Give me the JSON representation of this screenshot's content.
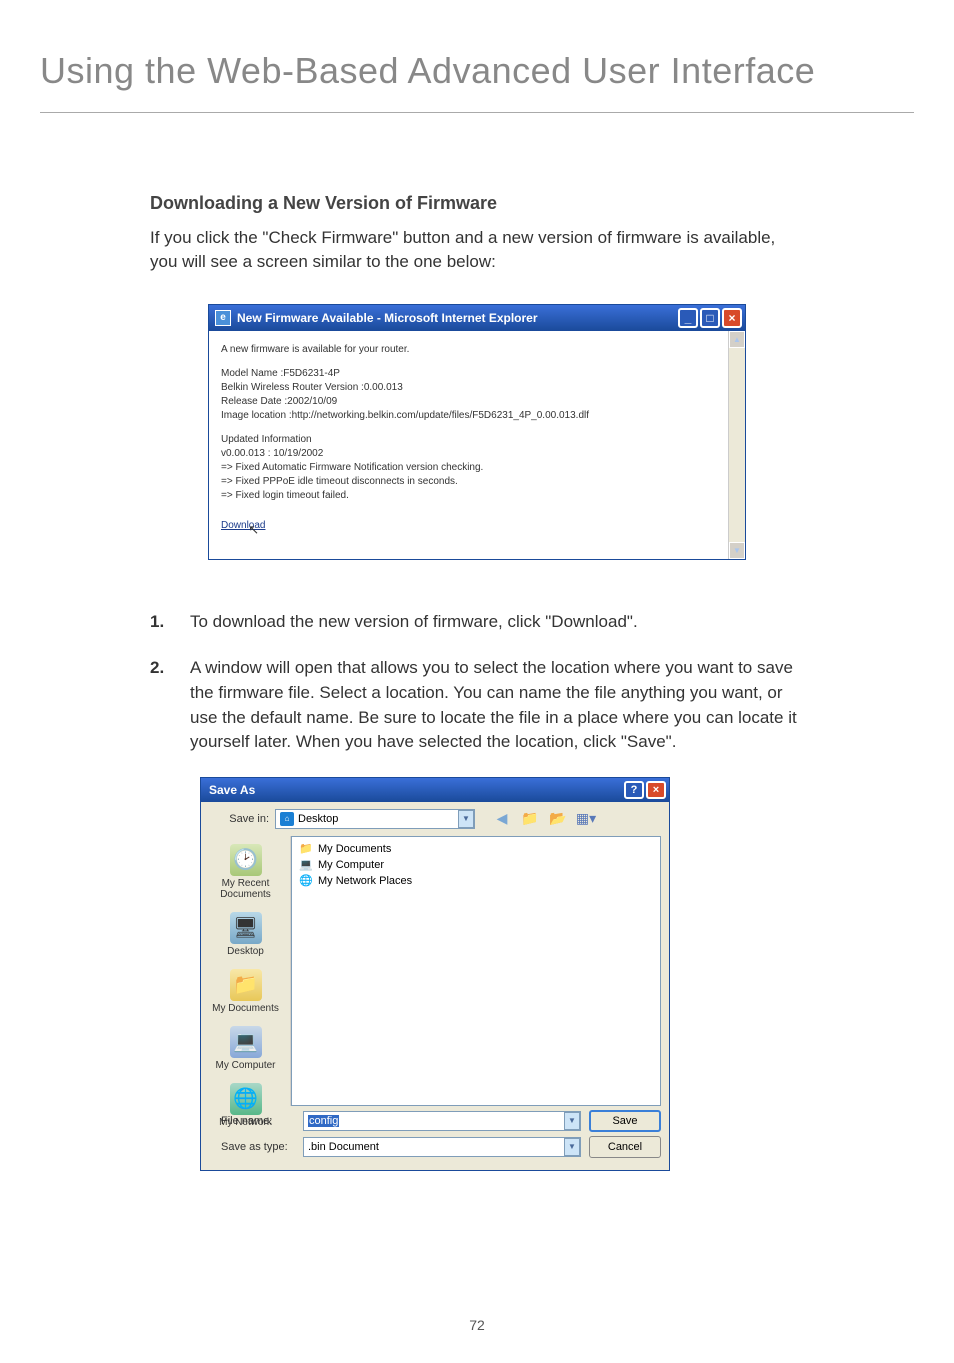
{
  "page": {
    "title": "Using the Web-Based Advanced User Interface",
    "number": "72"
  },
  "section": {
    "heading": "Downloading a New Version of Firmware",
    "intro": "If you click the \"Check Firmware\" button and a new version of firmware is available, you will see a screen similar to the one below:"
  },
  "ie_window": {
    "title": "New Firmware Available - Microsoft Internet Explorer",
    "line_intro": "A new firmware is available for your router.",
    "model": "Model Name :F5D6231-4P",
    "version": "Belkin Wireless Router Version :0.00.013",
    "release": "Release Date :2002/10/09",
    "image_loc": "Image location :http://networking.belkin.com/update/files/F5D6231_4P_0.00.013.dlf",
    "upd_head": "Updated Information",
    "upd_ver": "v0.00.013 : 10/19/2002",
    "upd_1": "=> Fixed Automatic Firmware Notification version checking.",
    "upd_2": "=> Fixed PPPoE idle timeout disconnects in seconds.",
    "upd_3": "=> Fixed login timeout failed.",
    "download": "Download"
  },
  "steps": {
    "s1_num": "1.",
    "s1_text": "To download the new version of firmware, click \"Download\".",
    "s2_num": "2.",
    "s2_text": "A window will open that allows you to select the location where you want to save the firmware file. Select a location. You can name the file anything you want, or use the default name. Be sure to locate the file in a place where you can locate it yourself later. When you have selected the location, click \"Save\"."
  },
  "saveas": {
    "title": "Save As",
    "savein_label": "Save in:",
    "savein_value": "Desktop",
    "files": {
      "f1": "My Documents",
      "f2": "My Computer",
      "f3": "My Network Places"
    },
    "places": {
      "recent": "My Recent Documents",
      "desktop": "Desktop",
      "docs": "My Documents",
      "computer": "My Computer",
      "network": "My Network"
    },
    "filename_label": "File name:",
    "filename_value": "config",
    "saveastype_label": "Save as type:",
    "saveastype_value": ".bin Document",
    "save_btn": "Save",
    "cancel_btn": "Cancel"
  }
}
